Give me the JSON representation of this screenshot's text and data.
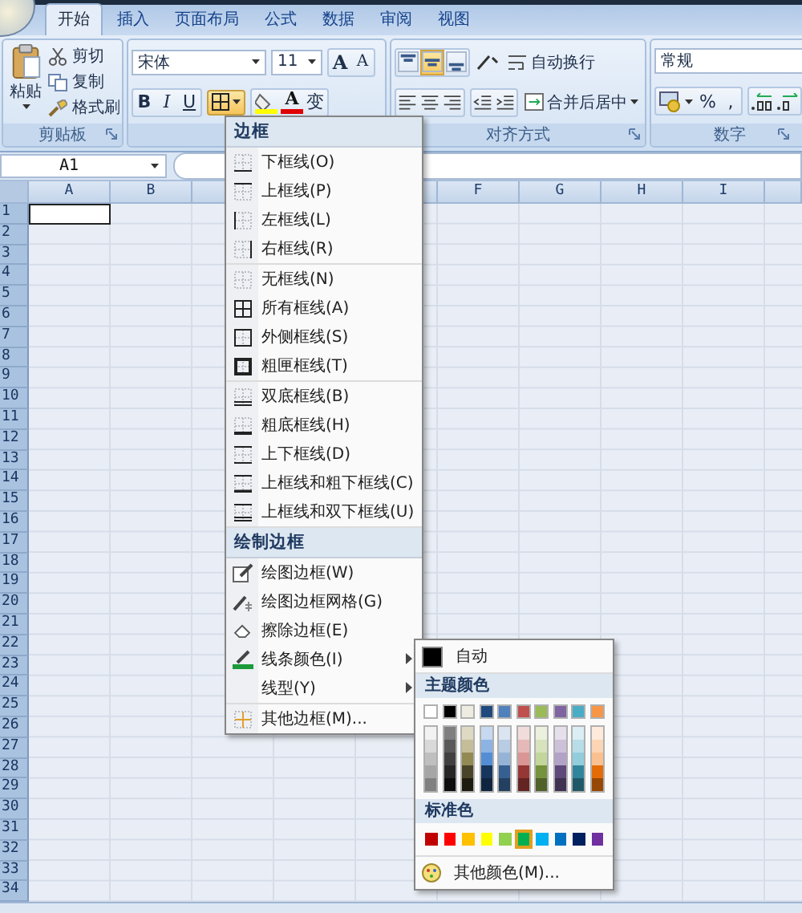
{
  "tabs": [
    {
      "label": "开始",
      "selected": true
    },
    {
      "label": "插入",
      "selected": false
    },
    {
      "label": "页面布局",
      "selected": false
    },
    {
      "label": "公式",
      "selected": false
    },
    {
      "label": "数据",
      "selected": false
    },
    {
      "label": "审阅",
      "selected": false
    },
    {
      "label": "视图",
      "selected": false
    }
  ],
  "clipboard": {
    "paste": "粘贴",
    "cut": "剪切",
    "copy": "复制",
    "format_painter": "格式刷",
    "label": "剪贴板"
  },
  "font": {
    "name": "宋体",
    "size": "11",
    "grow": "A",
    "shrink": "A",
    "bold": "B",
    "italic": "I",
    "underline": "U",
    "font_color": "A",
    "phonetic": "变",
    "borders_expanded": true
  },
  "alignment": {
    "vertical": [
      {
        "kind": "top",
        "selected": false
      },
      {
        "kind": "middle",
        "selected": true
      },
      {
        "kind": "bottom",
        "selected": false
      }
    ],
    "wrap_text": "自动换行",
    "merge_center": "合并后居中",
    "label": "对齐方式"
  },
  "number": {
    "format": "常规",
    "percent": "%",
    "comma": ",",
    "label": "数字"
  },
  "name_box": "A1",
  "columns": [
    "A",
    "B",
    "F",
    "G",
    "H",
    "I"
  ],
  "rows": [
    "1",
    "2",
    "3",
    "4",
    "5",
    "6",
    "7",
    "8",
    "9",
    "10",
    "11",
    "12",
    "13",
    "14",
    "15",
    "16",
    "17",
    "18",
    "19",
    "20",
    "21",
    "22",
    "23",
    "24",
    "25",
    "26",
    "27",
    "28",
    "29",
    "30",
    "31",
    "32",
    "33",
    "34"
  ],
  "border_menu": {
    "sections": [
      {
        "title": "边框",
        "groups": [
          [
            {
              "label": "下框线(O)",
              "kind": "bottom",
              "submenu": false
            },
            {
              "label": "上框线(P)",
              "kind": "top",
              "submenu": false
            },
            {
              "label": "左框线(L)",
              "kind": "left",
              "submenu": false
            },
            {
              "label": "右框线(R)",
              "kind": "right",
              "submenu": false
            }
          ],
          [
            {
              "label": "无框线(N)",
              "kind": "none",
              "submenu": false
            },
            {
              "label": "所有框线(A)",
              "kind": "all",
              "submenu": false
            },
            {
              "label": "外侧框线(S)",
              "kind": "outside",
              "submenu": false
            },
            {
              "label": "粗匣框线(T)",
              "kind": "thick_box",
              "submenu": false
            }
          ],
          [
            {
              "label": "双底框线(B)",
              "kind": "double_bottom",
              "submenu": false
            },
            {
              "label": "粗底框线(H)",
              "kind": "thick_bottom",
              "submenu": false
            },
            {
              "label": "上下框线(D)",
              "kind": "top_bottom",
              "submenu": false
            },
            {
              "label": "上框线和粗下框线(C)",
              "kind": "top_thick_bottom",
              "submenu": false
            },
            {
              "label": "上框线和双下框线(U)",
              "kind": "top_double_bottom",
              "submenu": false
            }
          ]
        ]
      },
      {
        "title": "绘制边框",
        "groups": [
          [
            {
              "label": "绘图边框(W)",
              "kind": "draw",
              "submenu": false
            },
            {
              "label": "绘图边框网格(G)",
              "kind": "draw_grid",
              "submenu": false
            },
            {
              "label": "擦除边框(E)",
              "kind": "erase",
              "submenu": false
            },
            {
              "label": "线条颜色(I)",
              "kind": "line_color",
              "submenu": true
            },
            {
              "label": "线型(Y)",
              "kind": "line_style",
              "submenu": true
            }
          ],
          [
            {
              "label": "其他边框(M)...",
              "kind": "more",
              "submenu": false
            }
          ]
        ]
      }
    ]
  },
  "color_menu": {
    "automatic": "自动",
    "theme_title": "主题颜色",
    "theme": [
      {
        "shades": [
          {
            "color": "#ffffff"
          },
          {
            "color": "#f2f2f2"
          },
          {
            "color": "#d9d9d9"
          },
          {
            "color": "#bfbfbf"
          },
          {
            "color": "#a6a6a6"
          },
          {
            "color": "#808080"
          }
        ]
      },
      {
        "shades": [
          {
            "color": "#000000"
          },
          {
            "color": "#7f7f7f"
          },
          {
            "color": "#595959"
          },
          {
            "color": "#404040"
          },
          {
            "color": "#262626"
          },
          {
            "color": "#0d0d0d"
          }
        ]
      },
      {
        "shades": [
          {
            "color": "#eeece1"
          },
          {
            "color": "#ddd9c3"
          },
          {
            "color": "#c4bd97"
          },
          {
            "color": "#938953"
          },
          {
            "color": "#494429"
          },
          {
            "color": "#1d1b10"
          }
        ]
      },
      {
        "shades": [
          {
            "color": "#1f497d"
          },
          {
            "color": "#c6d9f0"
          },
          {
            "color": "#8db3e2"
          },
          {
            "color": "#548dd4"
          },
          {
            "color": "#17365d"
          },
          {
            "color": "#0f243e"
          }
        ]
      },
      {
        "shades": [
          {
            "color": "#4f81bd"
          },
          {
            "color": "#dbe5f1"
          },
          {
            "color": "#b8cce4"
          },
          {
            "color": "#95b3d7"
          },
          {
            "color": "#366092"
          },
          {
            "color": "#244061"
          }
        ]
      },
      {
        "shades": [
          {
            "color": "#c0504d"
          },
          {
            "color": "#f2dcdb"
          },
          {
            "color": "#e5b9b7"
          },
          {
            "color": "#d99694"
          },
          {
            "color": "#953734"
          },
          {
            "color": "#632423"
          }
        ]
      },
      {
        "shades": [
          {
            "color": "#9bbb59"
          },
          {
            "color": "#ebf1dd"
          },
          {
            "color": "#d7e3bc"
          },
          {
            "color": "#c3d69b"
          },
          {
            "color": "#76923c"
          },
          {
            "color": "#4f6128"
          }
        ]
      },
      {
        "shades": [
          {
            "color": "#8064a2"
          },
          {
            "color": "#e5e0ec"
          },
          {
            "color": "#ccc1d9"
          },
          {
            "color": "#b2a2c7"
          },
          {
            "color": "#5f497a"
          },
          {
            "color": "#3f3151"
          }
        ]
      },
      {
        "shades": [
          {
            "color": "#4bacc6"
          },
          {
            "color": "#dbeef3"
          },
          {
            "color": "#b7dde8"
          },
          {
            "color": "#92cddc"
          },
          {
            "color": "#31859b"
          },
          {
            "color": "#205867"
          }
        ]
      },
      {
        "shades": [
          {
            "color": "#f79646"
          },
          {
            "color": "#fdeada"
          },
          {
            "color": "#fbd5b5"
          },
          {
            "color": "#fac08f"
          },
          {
            "color": "#e36c09"
          },
          {
            "color": "#974806"
          }
        ]
      }
    ],
    "standard_title": "标准色",
    "standard": [
      {
        "color": "#c00000",
        "selected": false
      },
      {
        "color": "#ff0000",
        "selected": false
      },
      {
        "color": "#ffc000",
        "selected": false
      },
      {
        "color": "#ffff00",
        "selected": false
      },
      {
        "color": "#92d050",
        "selected": false
      },
      {
        "color": "#00b050",
        "selected": true
      },
      {
        "color": "#00b0f0",
        "selected": false
      },
      {
        "color": "#0070c0",
        "selected": false
      },
      {
        "color": "#002060",
        "selected": false
      },
      {
        "color": "#7030a0",
        "selected": false
      }
    ],
    "more": "其他颜色(M)..."
  }
}
